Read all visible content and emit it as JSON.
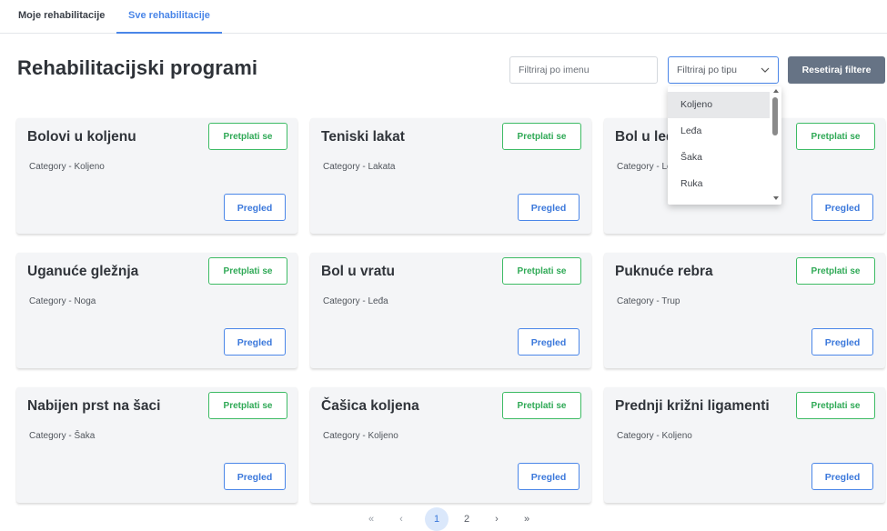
{
  "tabs": [
    {
      "label": "Moje rehabilitacije",
      "active": false
    },
    {
      "label": "Sve rehabilitacije",
      "active": true
    }
  ],
  "page": {
    "title": "Rehabilitacijski programi"
  },
  "filters": {
    "name_placeholder": "Filtriraj po imenu",
    "name_value": "",
    "type_label": "Filtriraj po tipu",
    "reset_label": "Resetiraj filtere",
    "type_options": [
      "Koljeno",
      "Leđa",
      "Šaka",
      "Ruka"
    ],
    "type_highlighted": "Koljeno"
  },
  "cards": [
    {
      "title": "Bolovi u koljenu",
      "category": "Category - Koljeno",
      "subscribe": "Pretplati se",
      "view": "Pregled"
    },
    {
      "title": "Teniski lakat",
      "category": "Category - Lakata",
      "subscribe": "Pretplati se",
      "view": "Pregled"
    },
    {
      "title": "Bol u leđima",
      "category": "Category - Leđa",
      "subscribe": "Pretplati se",
      "view": "Pregled"
    },
    {
      "title": "Uganuće gležnja",
      "category": "Category - Noga",
      "subscribe": "Pretplati se",
      "view": "Pregled"
    },
    {
      "title": "Bol u vratu",
      "category": "Category - Leđa",
      "subscribe": "Pretplati se",
      "view": "Pregled"
    },
    {
      "title": "Puknuće rebra",
      "category": "Category - Trup",
      "subscribe": "Pretplati se",
      "view": "Pregled"
    },
    {
      "title": "Nabijen prst na šaci",
      "category": "Category - Šaka",
      "subscribe": "Pretplati se",
      "view": "Pregled"
    },
    {
      "title": "Čašica koljena",
      "category": "Category - Koljeno",
      "subscribe": "Pretplati se",
      "view": "Pregled"
    },
    {
      "title": "Prednji križni ligamenti",
      "category": "Category - Koljeno",
      "subscribe": "Pretplati se",
      "view": "Pregled"
    }
  ],
  "pagination": {
    "first": "«",
    "prev": "‹",
    "pages": [
      "1",
      "2"
    ],
    "current": "1",
    "next": "›",
    "last": "»"
  },
  "colors": {
    "accent": "#4a86e8",
    "subscribe_green": "#2fa956",
    "reset_button": "#667385",
    "card_bg": "#f4f5f7"
  },
  "icons": {
    "type_filter": "chevron-down-icon"
  }
}
